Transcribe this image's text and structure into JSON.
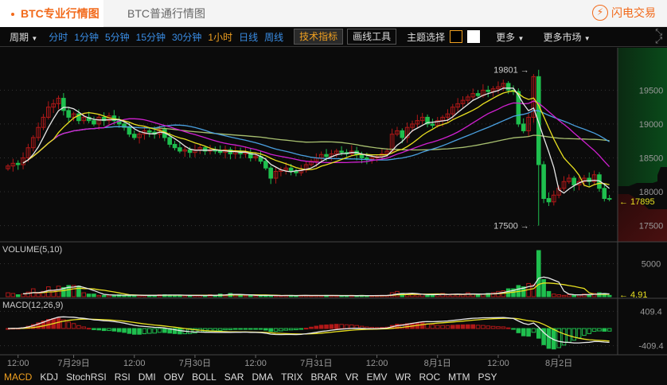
{
  "tabs": {
    "pro": "BTC专业行情图",
    "standard": "BTC普通行情图",
    "flash_trade": "闪电交易"
  },
  "toolbar": {
    "period": "周期",
    "intervals": [
      "分时",
      "1分钟",
      "5分钟",
      "15分钟",
      "30分钟",
      "1小时",
      "日线",
      "周线"
    ],
    "active_interval": "1小时",
    "indicators": "技术指标",
    "drawing": "画线工具",
    "theme": "主题选择",
    "more": "更多",
    "more_markets": "更多市场"
  },
  "colors": {
    "up": "#8b1010",
    "down": "#1fbf4e",
    "ma5": "#e8e8e8",
    "ma10": "#e8e020",
    "ma20": "#d020d0",
    "ma30": "#4aa0e0",
    "ma60": "#a8c070",
    "accent": "#f26a1b"
  },
  "volume_label": "VOLUME(5,10)",
  "macd_label": "MACD(12,26,9)",
  "indicator_tabs": [
    "MACD",
    "KDJ",
    "StochRSI",
    "RSI",
    "DMI",
    "OBV",
    "BOLL",
    "SAR",
    "DMA",
    "TRIX",
    "BRAR",
    "VR",
    "EMV",
    "WR",
    "ROC",
    "MTM",
    "PSY"
  ],
  "active_indicator": "MACD",
  "chart_data": {
    "type": "candlestick",
    "price_ticks": [
      19500,
      19000,
      18500,
      18000,
      17500
    ],
    "price_range": [
      17260,
      20080
    ],
    "high_marker": "19801",
    "low_marker": "17500",
    "high_value": 19801,
    "low_value": 17500,
    "extreme_index": 105,
    "last_price": "17895",
    "volume_tick": "5000",
    "volume_last": "4.91",
    "volume_max": 7600,
    "macd_ticks": [
      "409.4",
      "-409.4"
    ],
    "time_labels": [
      "12:00",
      "7月29日",
      "12:00",
      "7月30日",
      "12:00",
      "7月31日",
      "12:00",
      "8月1日",
      "12:00",
      "8月2日"
    ],
    "time_label_hour_index": [
      2,
      13,
      25,
      37,
      49,
      61,
      73,
      85,
      97,
      109
    ],
    "closes": [
      18380,
      18420,
      18400,
      18500,
      18650,
      18800,
      18950,
      19100,
      19250,
      19300,
      19380,
      19200,
      19100,
      19150,
      19050,
      19100,
      19050,
      19000,
      19100,
      19050,
      19120,
      19050,
      19000,
      18950,
      18850,
      18800,
      18850,
      18900,
      18880,
      18850,
      18920,
      18800,
      18700,
      18650,
      18600,
      18620,
      18580,
      18620,
      18650,
      18600,
      18620,
      18600,
      18580,
      18620,
      18560,
      18600,
      18560,
      18580,
      18500,
      18520,
      18450,
      18350,
      18200,
      18300,
      18320,
      18350,
      18300,
      18280,
      18320,
      18400,
      18450,
      18500,
      18550,
      18520,
      18560,
      18600,
      18580,
      18560,
      18600,
      18550,
      18500,
      18480,
      18500,
      18520,
      18560,
      18600,
      18850,
      18900,
      18800,
      18950,
      19000,
      19050,
      19100,
      19000,
      18980,
      19050,
      19100,
      19150,
      19250,
      19300,
      19350,
      19400,
      19450,
      19420,
      19500,
      19480,
      19520,
      19550,
      19600,
      19500,
      19480,
      19000,
      18900,
      19100,
      19700,
      18400,
      17900,
      17850,
      17950,
      18050,
      18150,
      18200,
      18100,
      18150,
      18200,
      18150,
      18250,
      18050,
      17900,
      17895
    ],
    "volumes": [
      600,
      500,
      300,
      400,
      700,
      1200,
      500,
      800,
      1500,
      900,
      1600,
      1400,
      1700,
      1700,
      1600,
      600,
      400,
      400,
      200,
      200,
      250,
      200,
      300,
      200,
      250,
      200,
      200,
      200,
      200,
      200,
      300,
      300,
      250,
      200,
      200,
      200,
      150,
      200,
      200,
      150,
      300,
      200,
      400,
      300,
      500,
      300,
      200,
      200,
      200,
      200,
      150,
      200,
      200,
      150,
      150,
      200,
      200,
      150,
      200,
      200,
      150,
      200,
      150,
      200,
      200,
      150,
      150,
      150,
      200,
      150,
      200,
      150,
      150,
      200,
      200,
      200,
      600,
      800,
      500,
      300,
      400,
      300,
      400,
      200,
      300,
      400,
      500,
      300,
      400,
      400,
      300,
      600,
      400,
      300,
      400,
      500,
      600,
      800,
      900,
      1200,
      1200,
      1700,
      1500,
      2000,
      1800,
      7000,
      2600,
      800,
      400,
      300,
      200,
      300,
      300,
      300,
      400,
      300,
      500,
      600,
      500,
      200
    ]
  }
}
